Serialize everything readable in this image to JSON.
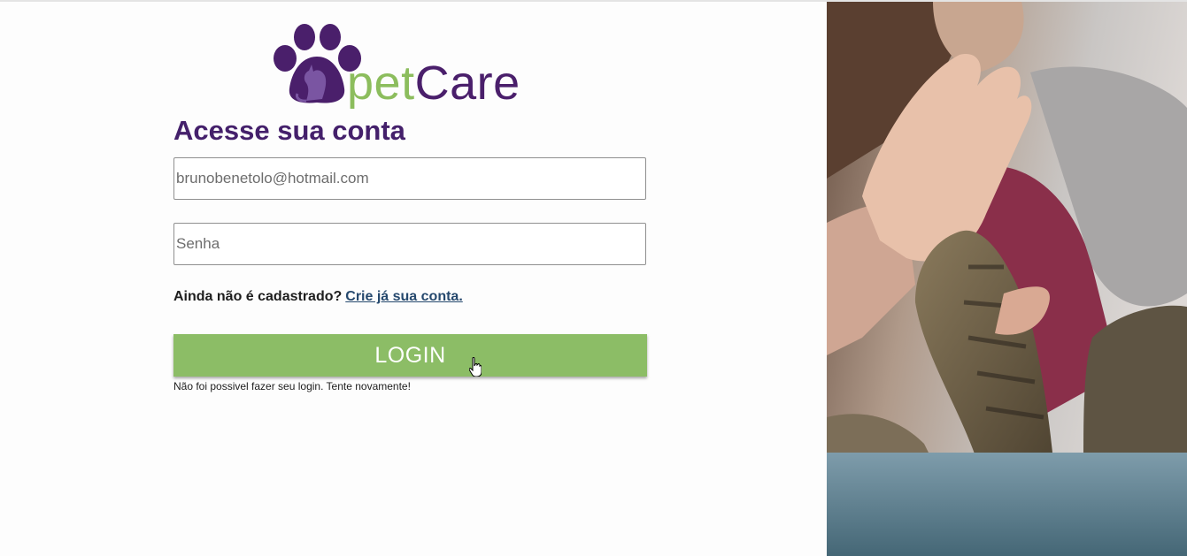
{
  "logo": {
    "word_pet": "pet",
    "word_care": "Care",
    "colors": {
      "pet": "#8cbd5d",
      "care": "#4a1f6b",
      "paw": "#4a1f6b"
    },
    "icon": "paw-icon"
  },
  "login_form": {
    "heading": "Acesse sua conta",
    "email_value": "brunobenetolo@hotmail.com",
    "password_placeholder": "Senha",
    "signup_prompt": "Ainda não é cadastrado?",
    "signup_link": "Crie já sua conta.",
    "login_button": "LOGIN",
    "error_message": "Não foi possivel fazer seu login. Tente novamente!"
  },
  "colors": {
    "heading": "#44206b",
    "button": "#8cbd66",
    "link": "#26496e"
  },
  "hero_image": {
    "subject": "hand high-fiving cat paw"
  }
}
